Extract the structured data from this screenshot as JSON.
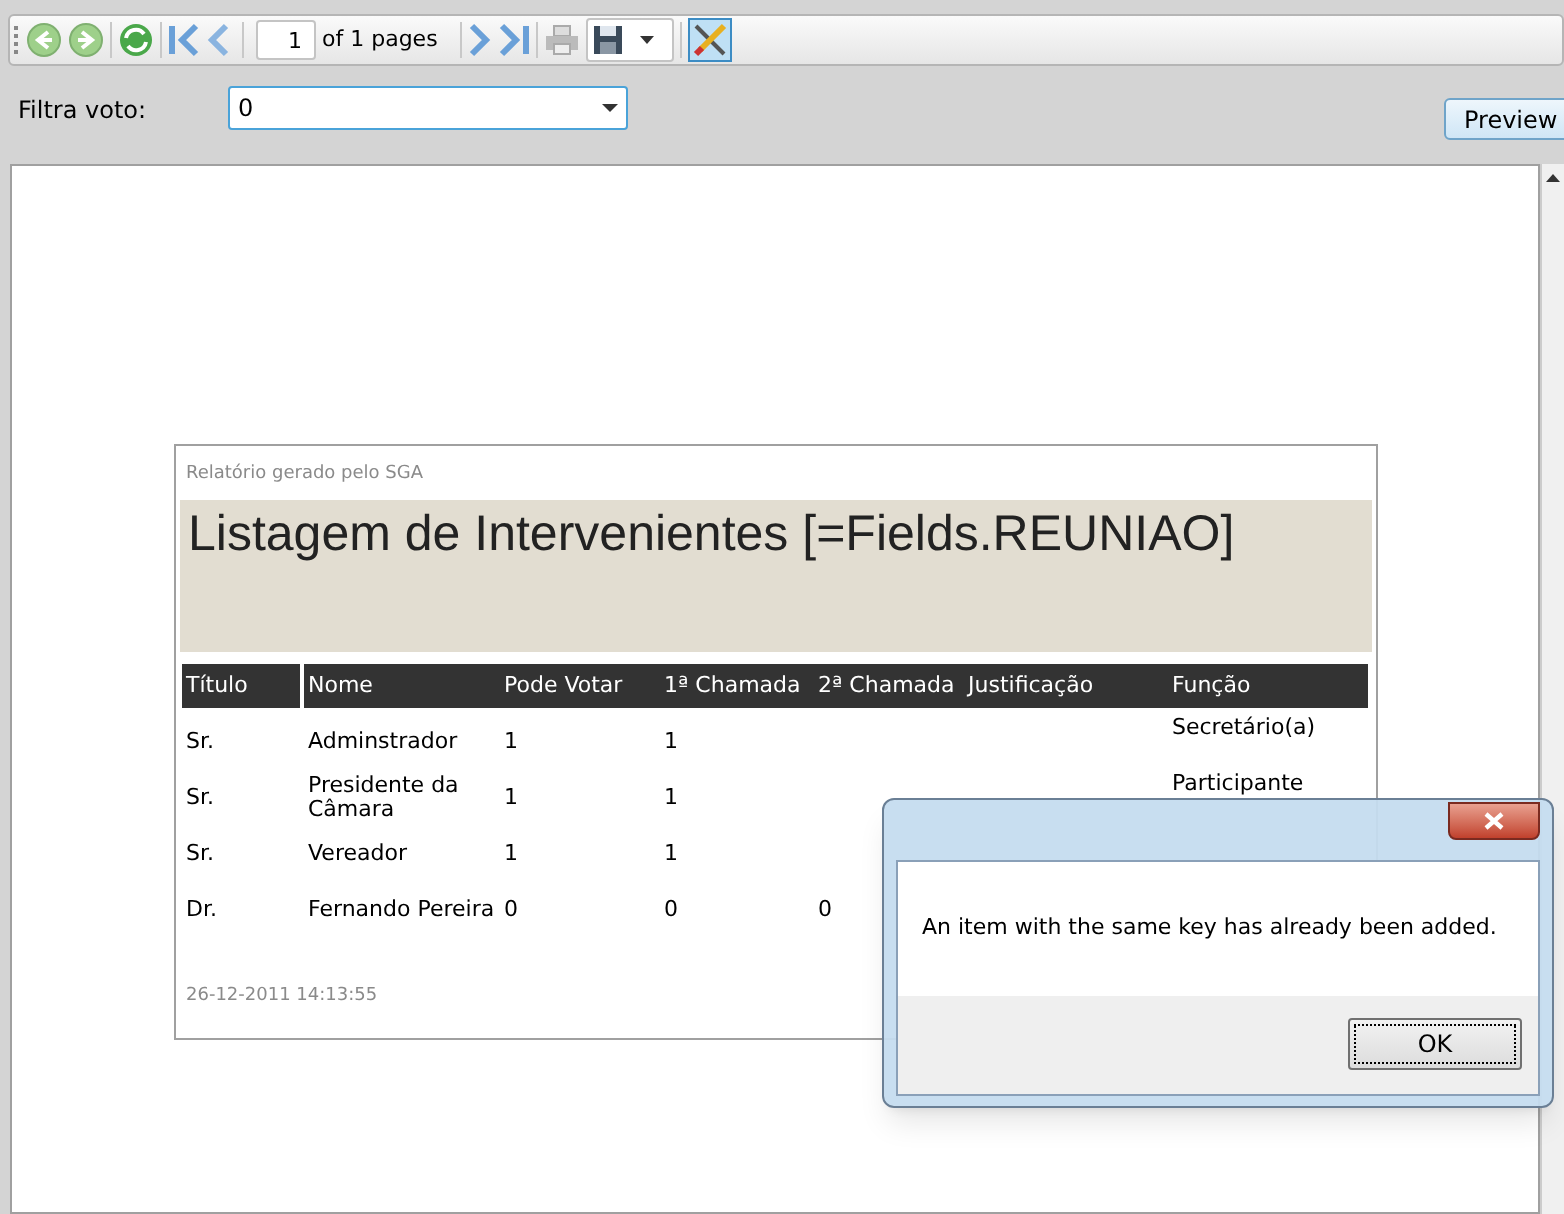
{
  "toolbar": {
    "page_number": "1",
    "page_count_label": "of 1 pages",
    "design_tools_selected": true
  },
  "filter": {
    "label": "Filtra voto:",
    "value": "0"
  },
  "preview_button": "Preview",
  "report": {
    "header_note": "Relatório gerado pelo SGA",
    "title": "Listagem de Intervenientes [=Fields.REUNIAO]",
    "columns": [
      "Título",
      "Nome",
      "Pode Votar",
      "1ª Chamada",
      "2ª Chamada",
      "Justificação",
      "Função"
    ],
    "rows": [
      {
        "cells": [
          "Sr.",
          "Adminstrador",
          "1",
          "1",
          null,
          null,
          "Secretário(a)"
        ]
      },
      {
        "cells": [
          "Sr.",
          "Presidente da Câmara",
          "1",
          "1",
          null,
          null,
          "Participante"
        ]
      },
      {
        "cells": [
          "Sr.",
          "Vereador",
          "1",
          "1",
          null,
          null,
          null
        ]
      },
      {
        "cells": [
          "Dr.",
          "Fernando Pereira",
          "0",
          "0",
          "0",
          null,
          null
        ]
      }
    ],
    "footer_timestamp": "26-12-2011 14:13:55"
  },
  "dialog": {
    "message": "An item with the same key has already been added.",
    "ok_button": "OK"
  }
}
